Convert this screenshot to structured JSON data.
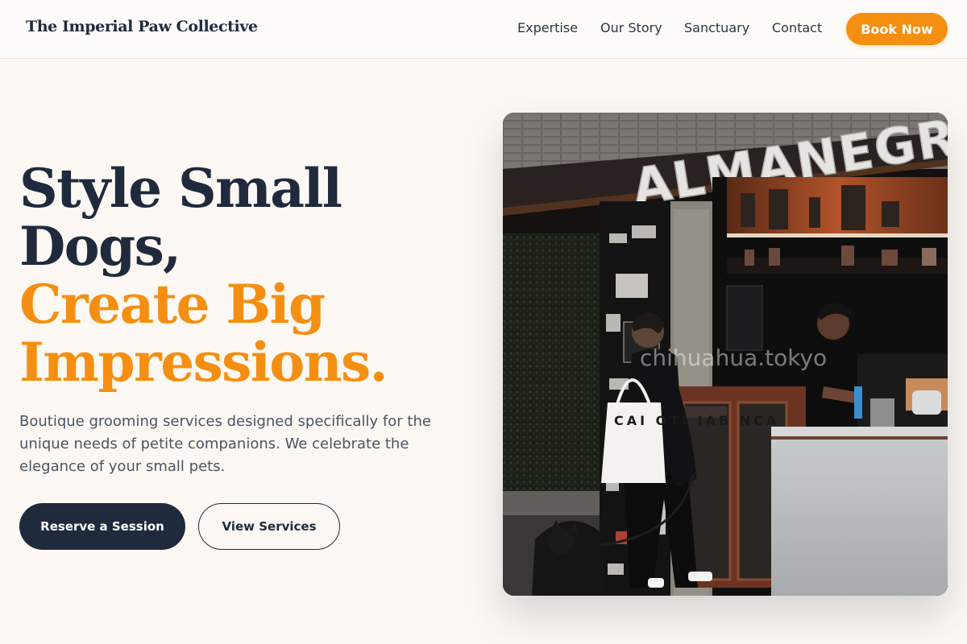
{
  "header": {
    "brand": "The Imperial Paw Collective",
    "nav": {
      "expertise": "Expertise",
      "our_story": "Our Story",
      "sanctuary": "Sanctuary",
      "contact": "Contact"
    },
    "book_label": "Book Now"
  },
  "hero": {
    "title_line1": "Style Small",
    "title_line2": "Dogs,",
    "title_line3": "Create Big",
    "title_line4": "Impressions.",
    "description": "Boutique grooming services designed specifically for the unique needs of petite companions. We celebrate the elegance of your small pets.",
    "primary_cta": "Reserve a Session",
    "secondary_cta": "View Services",
    "image": {
      "sign_text": "ALMANEGRA",
      "watermark": "chihuahua.tokyo",
      "bag_text": "CAI OTI IAB NCA"
    }
  },
  "colors": {
    "accent": "#f58f12",
    "navy": "#1f2a3d",
    "page_bg": "#fdf8f3"
  }
}
